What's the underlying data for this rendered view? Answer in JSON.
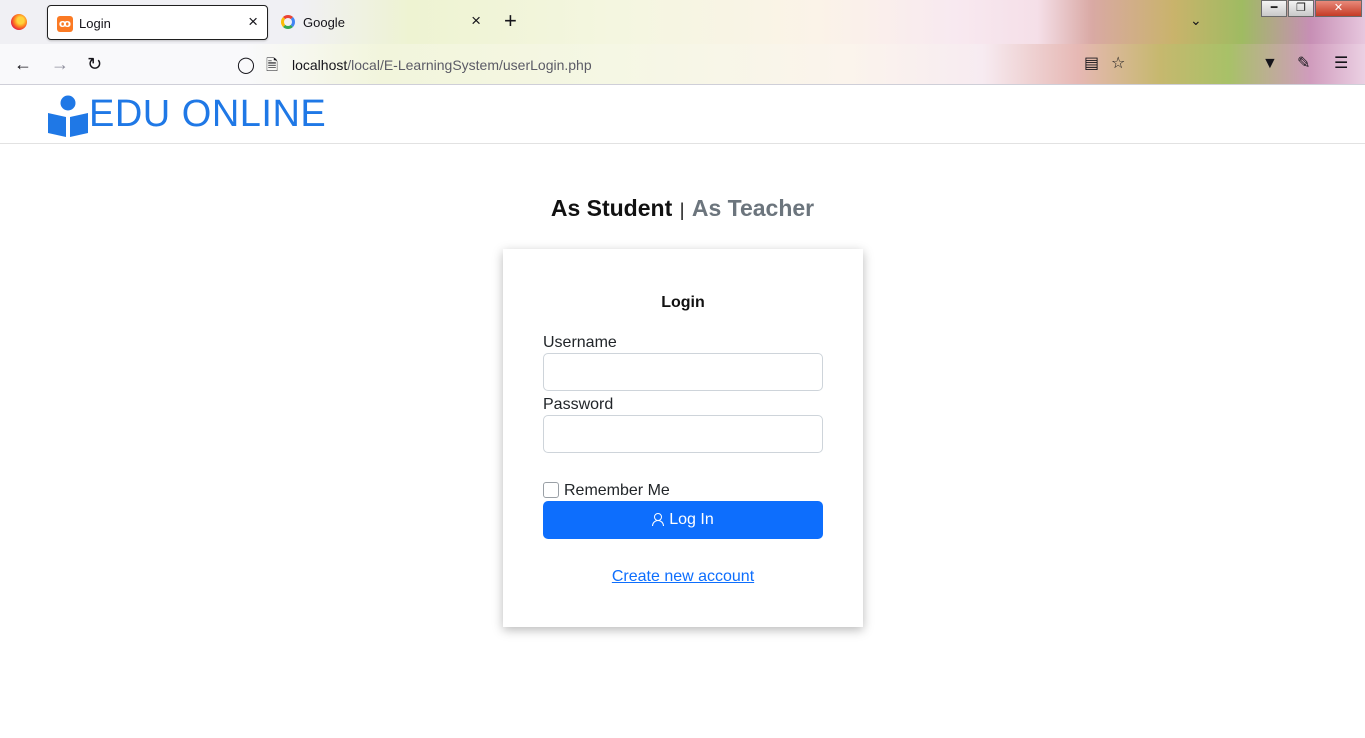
{
  "browser": {
    "tabs": [
      {
        "title": "Login",
        "icon": "xampp-icon",
        "active": true
      },
      {
        "title": "Google",
        "icon": "google-icon",
        "active": false
      }
    ],
    "new_tab_label": "+",
    "close_glyph": "×",
    "url": {
      "host": "localhost",
      "path": "/local/E-LearningSystem/userLogin.php"
    }
  },
  "site": {
    "brand": "EDU ONLINE",
    "brand_color": "#1f78e6"
  },
  "login": {
    "role_student": "As Student",
    "role_separator": "|",
    "role_teacher": "As Teacher",
    "title": "Login",
    "username_label": "Username",
    "username_value": "",
    "password_label": "Password",
    "password_value": "",
    "remember_label": "Remember Me",
    "remember_checked": false,
    "submit_label": "Log In",
    "create_account_label": "Create new account",
    "accent_color": "#0d6efd"
  }
}
